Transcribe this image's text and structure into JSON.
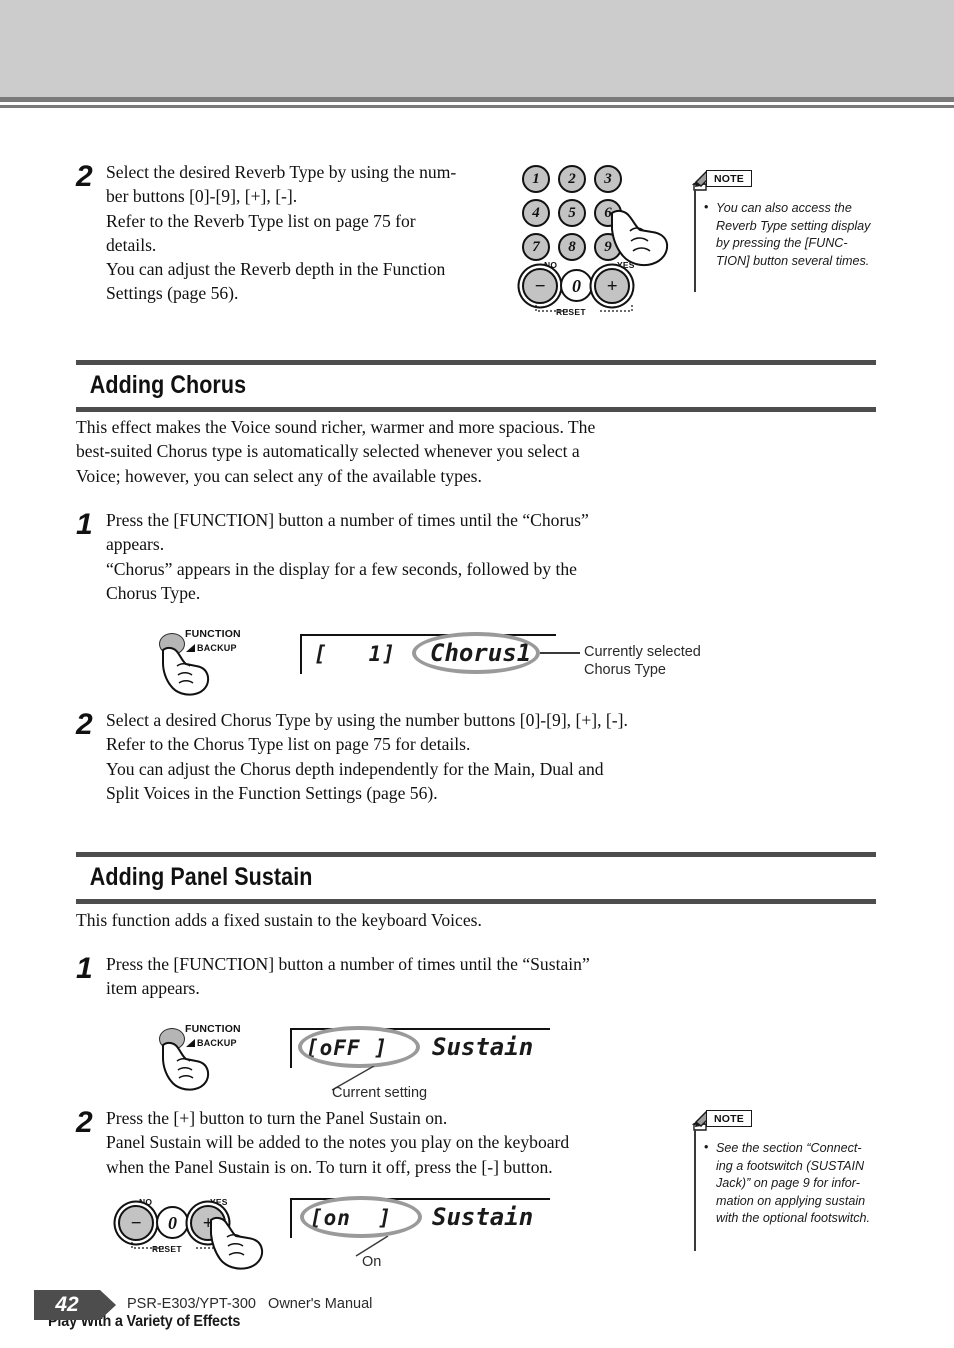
{
  "header": {
    "running_title": "Play With a Variety of Effects"
  },
  "reverb_step": {
    "number": "2",
    "lines": [
      "Select the desired Reverb Type by using the num-",
      "ber buttons [0]-[9], [+], [-].",
      "Refer to the Reverb Type list on page 75 for",
      "details.",
      "You can adjust the Reverb depth in the Function",
      "Settings (page 56)."
    ]
  },
  "keypad": {
    "digits": [
      "1",
      "2",
      "3",
      "4",
      "5",
      "6",
      "7",
      "8",
      "9"
    ],
    "minus": "−",
    "zero": "0",
    "plus": "+",
    "no_label": "NO",
    "yes_label": "YES",
    "reset_label": "RESET",
    "pressed_key": "6"
  },
  "note_reverb": {
    "tab_label": "NOTE",
    "bullet": "•",
    "lines": [
      "You can also access the",
      "Reverb Type setting display",
      "by pressing the [FUNC-",
      "TION] button several times."
    ]
  },
  "chorus_section": {
    "title": "Adding Chorus",
    "intro_lines": [
      "This effect makes the Voice sound richer, warmer and more spacious. The",
      "best-suited Chorus type is automatically selected whenever you select a",
      "Voice; however, you can select any of the available types."
    ],
    "step1": {
      "number": "1",
      "lines": [
        "Press the [FUNCTION] button a number of times until the “Chorus”",
        "appears.",
        "“Chorus” appears in the display for a few seconds, followed by the",
        "Chorus Type."
      ]
    },
    "step2": {
      "number": "2",
      "lines": [
        "Select a desired Chorus Type by using the number buttons [0]-[9], [+], [-].",
        "Refer to the Chorus Type list on page 75 for details.",
        "You can adjust the Chorus depth independently for the Main, Dual and",
        "Split Voices in the Function Settings (page 56)."
      ]
    },
    "lcd": {
      "value": "[   1]",
      "name": "Chorus1"
    },
    "callout_lines": [
      "Currently selected",
      "Chorus Type"
    ]
  },
  "function_button": {
    "label": "FUNCTION",
    "sub_label": "BACKUP"
  },
  "sustain_section": {
    "title": "Adding Panel Sustain",
    "intro_lines": [
      "This function adds a fixed sustain to the keyboard Voices."
    ],
    "step1": {
      "number": "1",
      "lines": [
        "Press the [FUNCTION] button a number of times until the “Sustain”",
        "item appears."
      ]
    },
    "step2": {
      "number": "2",
      "lines": [
        "Press the [+] button to turn the Panel Sustain on.",
        "Panel Sustain will be added to the notes you play on the keyboard",
        "when the Panel Sustain is on. To turn it off, press the [-] button."
      ]
    },
    "lcd_off": {
      "value": "[oFF ]",
      "name": "Sustain"
    },
    "callout_off": "Current setting",
    "lcd_on": {
      "value": "[on  ]",
      "name": "Sustain"
    },
    "callout_on": "On"
  },
  "note_sustain": {
    "tab_label": "NOTE",
    "bullet": "•",
    "lines": [
      "See the section “Connect-",
      "ing a footswitch (SUSTAIN",
      "Jack)” on page 9 for infor-",
      "mation on applying sustain",
      "with the optional footswitch."
    ]
  },
  "footer": {
    "page_number": "42",
    "manual_title": "PSR-E303/YPT-300   Owner's Manual"
  },
  "colors": {
    "header_band": "#cccccc",
    "rule_gray": "#7a7a7a",
    "section_rule": "#4d4d4d",
    "highlight_ellipse": "#9a9a9a",
    "key_fill": "#c3c3c3",
    "footer_tag": "#4d4d4d"
  }
}
